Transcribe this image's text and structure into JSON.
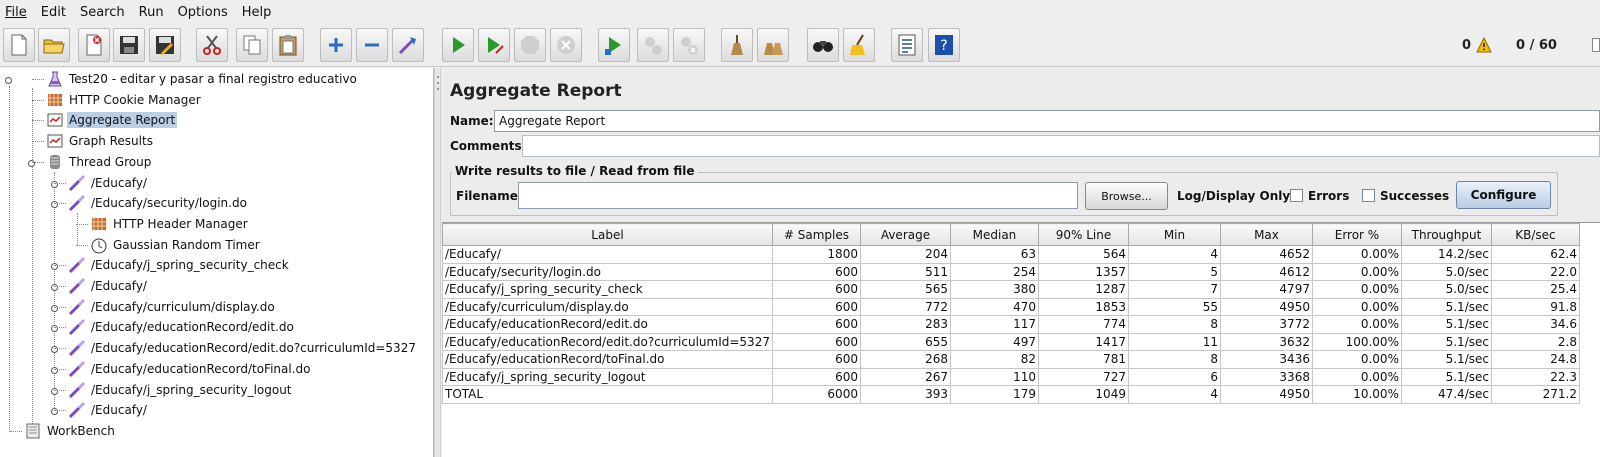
{
  "menu": [
    "File",
    "Edit",
    "Search",
    "Run",
    "Options",
    "Help"
  ],
  "toolbar": {
    "buttons": [
      "new-icon",
      "open-icon",
      "close-icon",
      "save-icon",
      "save-as-icon",
      "cut-icon",
      "copy-icon",
      "paste-icon",
      "expand-icon",
      "collapse-icon",
      "toggle-icon",
      "start-icon",
      "start-no-pause-icon",
      "stop-icon",
      "shutdown-icon",
      "remote-start-icon",
      "remote-stop-icon",
      "remote-shutdown-icon",
      "clear-icon",
      "clear-all-icon",
      "search-icon",
      "reset-search-icon",
      "function-helper-icon",
      "help-icon"
    ],
    "error_count": "0",
    "thread_count": "0 / 60"
  },
  "tree": {
    "items": [
      {
        "label": "Test20 - editar y pasar a final registro educativo",
        "icon": "test-plan-icon"
      },
      {
        "label": "HTTP Cookie Manager",
        "icon": "config-icon"
      },
      {
        "label": "Aggregate Report",
        "icon": "listener-icon",
        "selected": true
      },
      {
        "label": "Graph Results",
        "icon": "listener-icon"
      },
      {
        "label": "Thread Group",
        "icon": "thread-group-icon"
      },
      {
        "label": "/Educafy/",
        "icon": "sampler-icon"
      },
      {
        "label": "/Educafy/security/login.do",
        "icon": "sampler-icon"
      },
      {
        "label": "HTTP Header Manager",
        "icon": "config-icon"
      },
      {
        "label": "Gaussian Random Timer",
        "icon": "timer-icon"
      },
      {
        "label": "/Educafy/j_spring_security_check",
        "icon": "sampler-icon"
      },
      {
        "label": "/Educafy/",
        "icon": "sampler-icon"
      },
      {
        "label": "/Educafy/curriculum/display.do",
        "icon": "sampler-icon"
      },
      {
        "label": "/Educafy/educationRecord/edit.do",
        "icon": "sampler-icon"
      },
      {
        "label": "/Educafy/educationRecord/edit.do?curriculumId=5327",
        "icon": "sampler-icon"
      },
      {
        "label": "/Educafy/educationRecord/toFinal.do",
        "icon": "sampler-icon"
      },
      {
        "label": "/Educafy/j_spring_security_logout",
        "icon": "sampler-icon"
      },
      {
        "label": "/Educafy/",
        "icon": "sampler-icon"
      },
      {
        "label": "WorkBench",
        "icon": "workbench-icon"
      }
    ]
  },
  "panel": {
    "title": "Aggregate Report",
    "name_label": "Name:",
    "name_value": "Aggregate Report",
    "comments_label": "Comments:",
    "comments_value": "",
    "file_group_title": "Write results to file / Read from file",
    "filename_label": "Filename",
    "filename_value": "",
    "browse_label": "Browse...",
    "log_display_label": "Log/Display Only:",
    "errors_label": "Errors",
    "successes_label": "Successes",
    "configure_label": "Configure"
  },
  "table": {
    "columns": [
      "Label",
      "# Samples",
      "Average",
      "Median",
      "90% Line",
      "Min",
      "Max",
      "Error %",
      "Throughput",
      "KB/sec"
    ],
    "rows": [
      [
        "/Educafy/",
        "1800",
        "204",
        "63",
        "564",
        "4",
        "4652",
        "0.00%",
        "14.2/sec",
        "62.4"
      ],
      [
        "/Educafy/security/login.do",
        "600",
        "511",
        "254",
        "1357",
        "5",
        "4612",
        "0.00%",
        "5.0/sec",
        "22.0"
      ],
      [
        "/Educafy/j_spring_security_check",
        "600",
        "565",
        "380",
        "1287",
        "7",
        "4797",
        "0.00%",
        "5.0/sec",
        "25.4"
      ],
      [
        "/Educafy/curriculum/display.do",
        "600",
        "772",
        "470",
        "1853",
        "55",
        "4950",
        "0.00%",
        "5.1/sec",
        "91.8"
      ],
      [
        "/Educafy/educationRecord/edit.do",
        "600",
        "283",
        "117",
        "774",
        "8",
        "3772",
        "0.00%",
        "5.1/sec",
        "34.6"
      ],
      [
        "/Educafy/educationRecord/edit.do?curriculumId=5327",
        "600",
        "655",
        "497",
        "1417",
        "11",
        "3632",
        "100.00%",
        "5.1/sec",
        "2.8"
      ],
      [
        "/Educafy/educationRecord/toFinal.do",
        "600",
        "268",
        "82",
        "781",
        "8",
        "3436",
        "0.00%",
        "5.1/sec",
        "24.8"
      ],
      [
        "/Educafy/j_spring_security_logout",
        "600",
        "267",
        "110",
        "727",
        "6",
        "3368",
        "0.00%",
        "5.1/sec",
        "22.3"
      ],
      [
        "TOTAL",
        "6000",
        "393",
        "179",
        "1049",
        "4",
        "4950",
        "10.00%",
        "47.4/sec",
        "271.2"
      ]
    ]
  }
}
